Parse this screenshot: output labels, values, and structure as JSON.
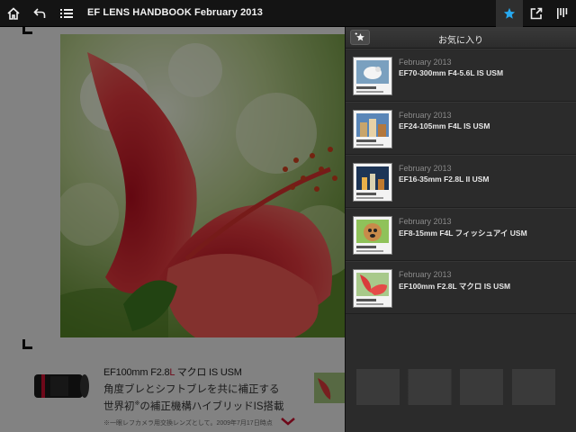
{
  "topbar": {
    "title": "EF LENS HANDBOOK February 2013",
    "buttons": [
      "home-icon",
      "back-icon",
      "toc-icon",
      "star-icon",
      "export-icon",
      "bookmark-bar-icon"
    ],
    "accent": "#27a9f0"
  },
  "page": {
    "caption_title_pre": "EF100mm F2.8",
    "caption_title_hl": "L",
    "caption_title_post": " マクロ IS USM",
    "caption_line1": "角度ブレとシフトブレを共に補正する",
    "caption_line2_pre": "世界初",
    "caption_line2_sup": "※",
    "caption_line2_post": "の補正機構ハイブリッドIS搭載",
    "caption_note": "※一眼レフカメラ用交換レンズとして。2009年7月17日時点",
    "highlight_color": "#c8102e"
  },
  "favorites": {
    "title": "お気に入り",
    "add_icon": "star-plus-icon",
    "items": [
      {
        "date": "February 2013",
        "name": "EF70-300mm F4-5.6L IS USM",
        "thumb": "bird"
      },
      {
        "date": "February 2013",
        "name": "EF24-105mm F4L IS USM",
        "thumb": "city"
      },
      {
        "date": "February 2013",
        "name": "EF16-35mm F2.8L II USM",
        "thumb": "night"
      },
      {
        "date": "February 2013",
        "name": "EF8-15mm F4L フィッシュアイ USM",
        "thumb": "dog"
      },
      {
        "date": "February 2013",
        "name": "EF100mm F2.8L マクロ  IS USM",
        "thumb": "flower"
      }
    ]
  }
}
